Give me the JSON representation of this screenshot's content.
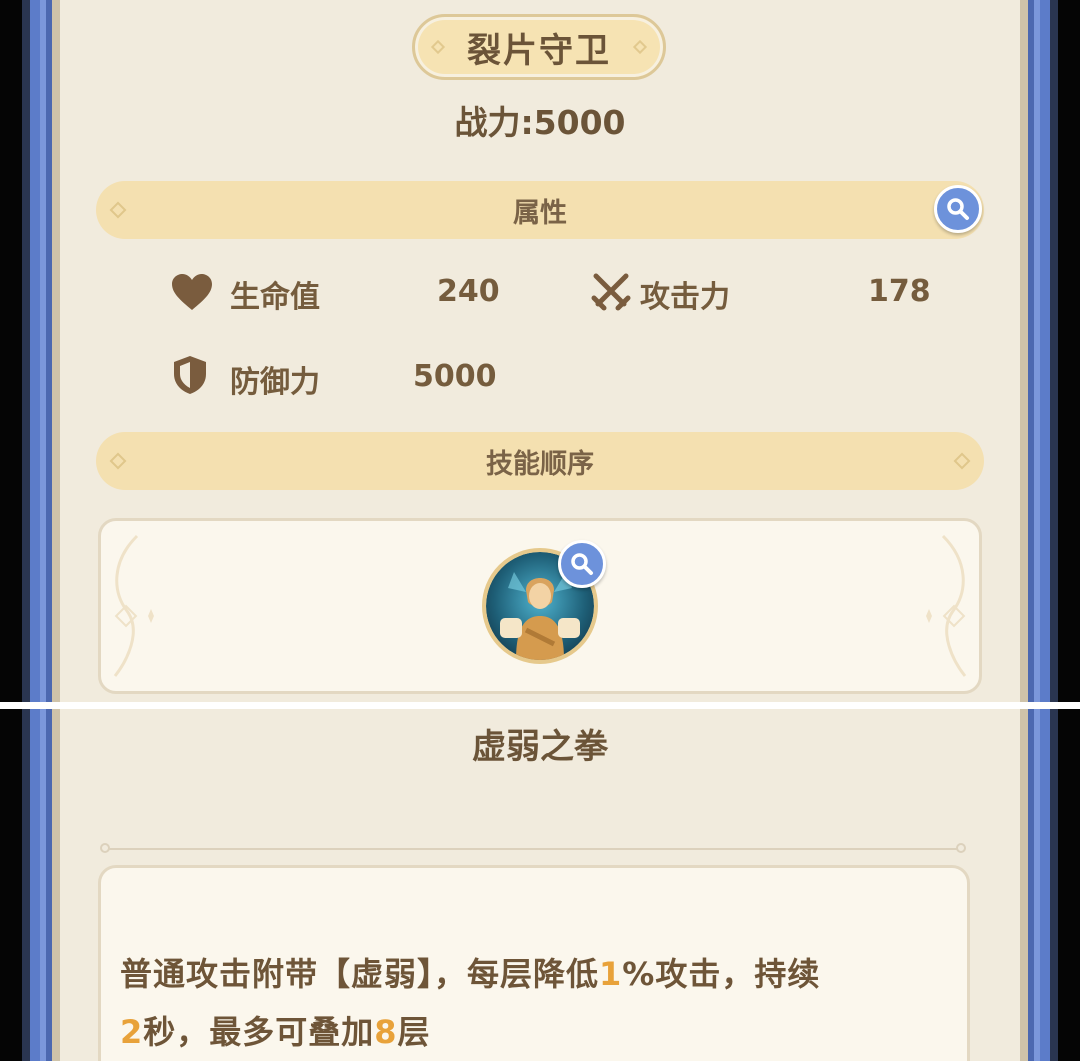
{
  "header": {
    "title": "裂片守卫",
    "power": "战力:5000"
  },
  "attributes": {
    "title": "属性",
    "stats": [
      {
        "icon": "heart-icon",
        "label": "生命值",
        "value": "240"
      },
      {
        "icon": "crossed-swords-icon",
        "label": "攻击力",
        "value": "178"
      },
      {
        "icon": "shield-icon",
        "label": "防御力",
        "value": "5000"
      }
    ]
  },
  "skill_order": {
    "title": "技能顺序"
  },
  "skill": {
    "name": "虚弱之拳",
    "description": {
      "p1": "普通攻击附带【虚弱】，每层降低",
      "n1": "1",
      "p2": "%攻击，持续",
      "n2": "2",
      "p3": "秒，最多可叠加",
      "n3": "8",
      "p4": "层"
    }
  },
  "colors": {
    "frame_blue": "#5c7cc9",
    "panel_bg": "#f1ebdd",
    "section_bar": "#f4e0b0",
    "text_brown": "#6b5438",
    "highlight_orange": "#e8a23a",
    "magnifier_blue": "#6d92db"
  }
}
